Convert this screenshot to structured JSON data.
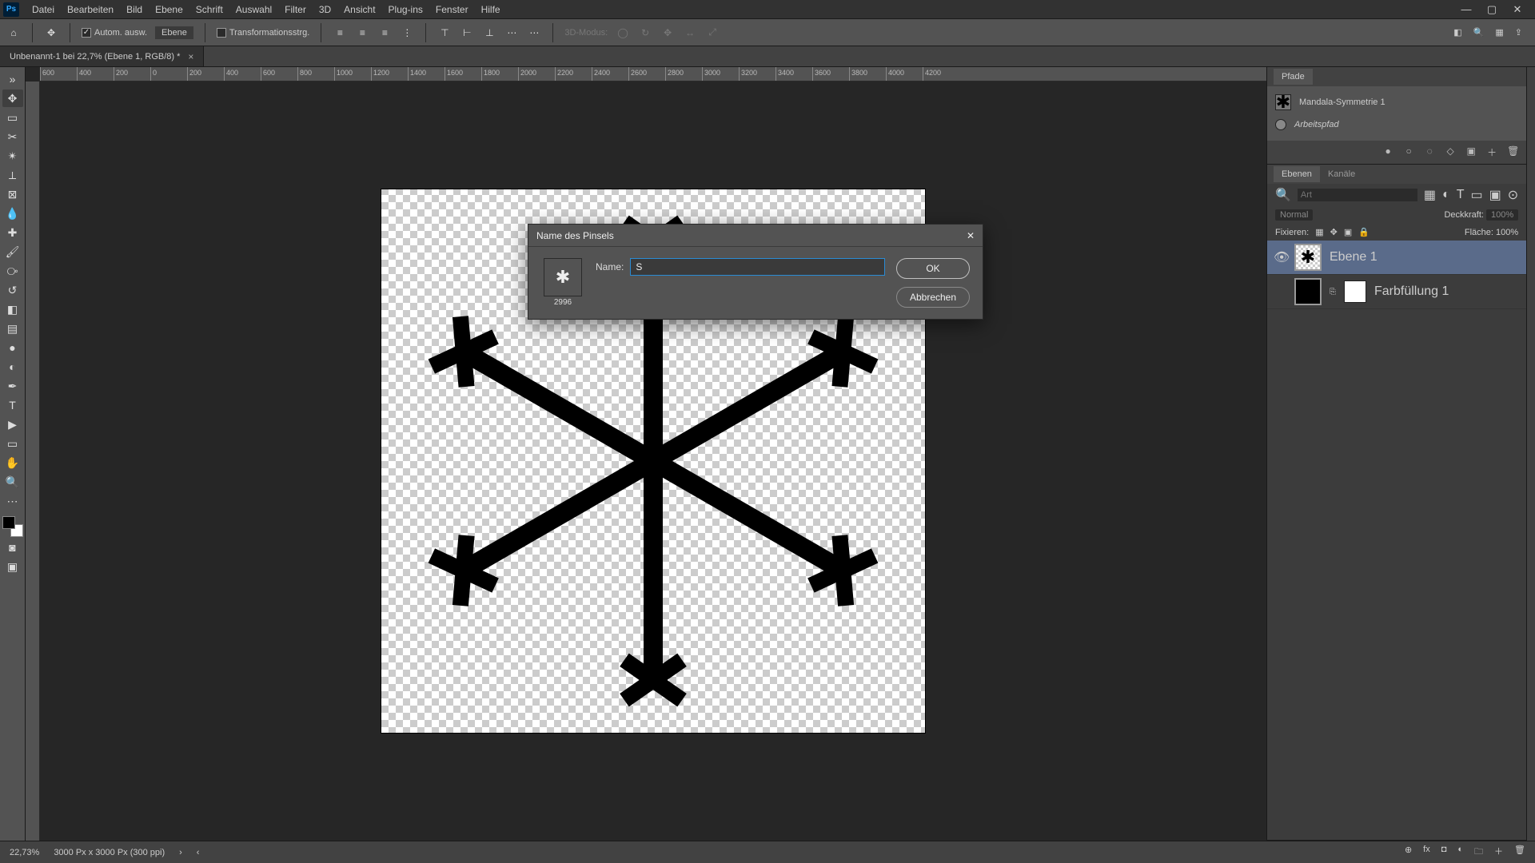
{
  "app": {
    "id": "Ps"
  },
  "menu": [
    "Datei",
    "Bearbeiten",
    "Bild",
    "Ebene",
    "Schrift",
    "Auswahl",
    "Filter",
    "3D",
    "Ansicht",
    "Plug-ins",
    "Fenster",
    "Hilfe"
  ],
  "options": {
    "auto_select_label": "Autom. ausw.",
    "auto_select_target": "Ebene",
    "transform_label": "Transformationsstrg.",
    "threed_mode": "3D-Modus:"
  },
  "doc_tab": {
    "title": "Unbenannt-1 bei 22,7% (Ebene 1, RGB/8) *"
  },
  "ruler_marks": [
    "600",
    "400",
    "200",
    "0",
    "200",
    "400",
    "600",
    "800",
    "1000",
    "1200",
    "1400",
    "1600",
    "1800",
    "2000",
    "2200",
    "2400",
    "2600",
    "2800",
    "3000",
    "3200",
    "3400",
    "3600",
    "3800",
    "4000",
    "4200"
  ],
  "paths_panel": {
    "tab": "Pfade",
    "items": [
      {
        "label": "Mandala-Symmetrie 1",
        "italic": false
      },
      {
        "label": "Arbeitspfad",
        "italic": true
      }
    ]
  },
  "layers_panel": {
    "tabs": [
      "Ebenen",
      "Kanäle"
    ],
    "search_placeholder": "Art",
    "blend_mode": "Normal",
    "opacity_label": "Deckkraft:",
    "opacity_value": "100%",
    "lock_label": "Fixieren:",
    "fill_label": "Fläche:",
    "fill_value": "100%",
    "layers": [
      {
        "name": "Ebene 1",
        "visible": true,
        "selected": true,
        "kind": "pixel"
      },
      {
        "name": "Farbfüllung 1",
        "visible": false,
        "selected": false,
        "kind": "fill"
      }
    ]
  },
  "dialog": {
    "title": "Name des Pinsels",
    "name_label": "Name:",
    "name_value": "S",
    "brush_size": "2996",
    "ok": "OK",
    "cancel": "Abbrechen"
  },
  "status": {
    "zoom": "22,73%",
    "doc_info": "3000 Px x 3000 Px (300 ppi)"
  }
}
